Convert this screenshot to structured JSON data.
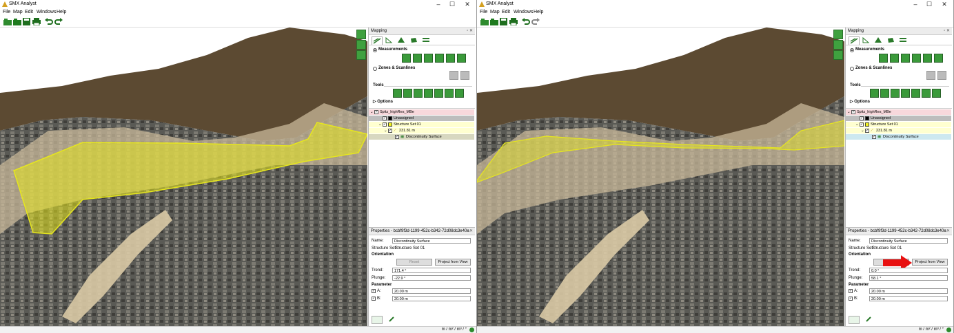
{
  "window": {
    "title": "SMX Analyst"
  },
  "menu": {
    "file": "File",
    "map": "Map",
    "edit": "Edit",
    "windows": "Windows",
    "help": "Help"
  },
  "mapping_panel": {
    "title": "Mapping",
    "measurements": "Measurements",
    "zones": "Zones & Scanlines",
    "tools": "Tools",
    "options": "Options"
  },
  "tree": {
    "root": "Spitz_highRes_MBe",
    "unassigned": "Unassigned",
    "structure_set": "Structure Set 01",
    "measure": "231.81 m",
    "surface": "Discontinuity Surface"
  },
  "properties": {
    "title": "Properties - bcbf9f3d-1199-452c-b342-72d08dc3e40a",
    "name_label": "Name:",
    "name_value": "Discontinuity Surface",
    "structure_set_label": "Structure Set:",
    "structure_set_value": "Structure Set 01",
    "orientation": "Orientation",
    "reset": "Reset",
    "project": "Project from View",
    "trend_label": "Trend:",
    "plunge_label": "Plunge:",
    "parameter": "Parameter",
    "a_label": "A:",
    "b_label": "B:",
    "a_value": "20.00 m",
    "b_value": "20.00 m"
  },
  "left": {
    "trend": "171.4 °",
    "plunge": "-22.9 °"
  },
  "right": {
    "trend": "0.0 °",
    "plunge": "58.1 °"
  },
  "status": {
    "units": "m / m² / m³ / °"
  },
  "colors": {
    "surface": "#e6e61e",
    "highlight_red": "#e81010",
    "tree_pink": "#f8d8dc",
    "tree_yellow": "#ffffd0"
  }
}
